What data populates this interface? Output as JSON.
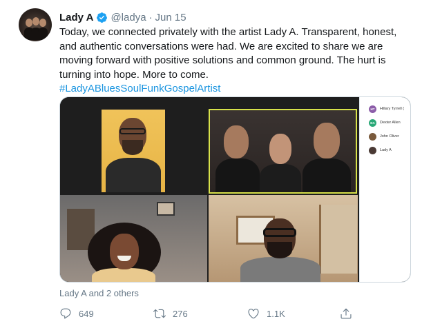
{
  "tweet": {
    "author_name": "Lady A",
    "handle": "@ladya",
    "separator": "·",
    "date": "Jun 15",
    "text": "Today, we connected privately with the artist Lady A. Transparent, honest, and authentic conversations were had. We are excited to share we are moving forward with positive solutions and common ground. The hurt is turning into hope. More to come.",
    "hashtag": "#LadyABluesSoulFunkGospelArtist",
    "liked_by": "Lady A and 2 others",
    "brand_color": "#1da1f2",
    "link_color": "#1b95e0"
  },
  "participants": [
    {
      "initials": "HT",
      "name": "Hillary Tyrrell (",
      "avatar_color": "#8b5ca8"
    },
    {
      "initials": "DA",
      "name": "Dexter Allen",
      "avatar_color": "#2aa877"
    },
    {
      "initials": "",
      "name": "John Oliver",
      "avatar_color": "#7a5a3c"
    },
    {
      "initials": "",
      "name": "Lady A",
      "avatar_color": "#4a3a35"
    }
  ],
  "actions": {
    "reply_count": "649",
    "retweet_count": "276",
    "like_count": "1.1K"
  },
  "icons": [
    "verified-badge-icon",
    "reply-icon",
    "retweet-icon",
    "like-icon",
    "share-icon"
  ]
}
